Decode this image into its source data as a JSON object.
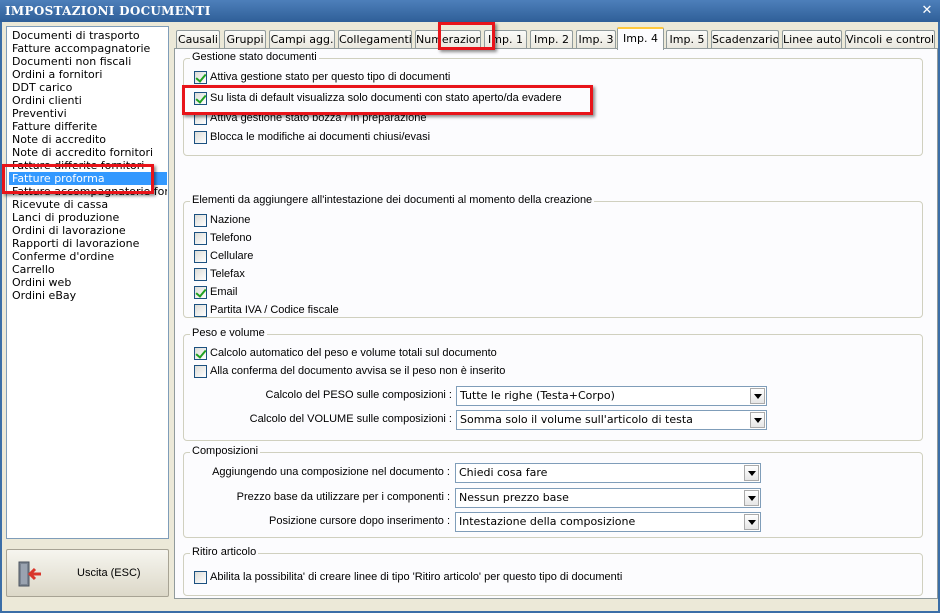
{
  "window": {
    "title": "IMPOSTAZIONI DOCUMENTI",
    "close_glyph": "✕"
  },
  "doc_list": {
    "items": [
      "Documenti di trasporto",
      "Fatture accompagnatorie",
      "Documenti non fiscali",
      "Ordini a fornitori",
      "DDT carico",
      "Ordini clienti",
      "Preventivi",
      "Fatture differite",
      "Note di accredito",
      "Note di accredito fornitori",
      "Fatture differite fornitori",
      "Fatture proforma",
      "Fatture accompagnatorie fornitori",
      "Ricevute di cassa",
      "Lanci di produzione",
      "Ordini di lavorazione",
      "Rapporti di lavorazione",
      "Conferme d'ordine",
      "Carrello",
      "Ordini web",
      "Ordini eBay"
    ],
    "selected": "Fatture proforma"
  },
  "exit_button": {
    "label": "Uscita (ESC)",
    "icon": "exit-door-icon"
  },
  "tabs": [
    "Causali",
    "Gruppi",
    "Campi agg.",
    "Collegamenti",
    "Numerazioni",
    "Imp. 1",
    "Imp. 2",
    "Imp. 3",
    "Imp. 4",
    "Imp. 5",
    "Scadenzario",
    "Linee auto",
    "Vincoli e controlli"
  ],
  "active_tab": "Imp. 4",
  "groups": {
    "stato": {
      "title": "Gestione stato documenti",
      "options": [
        {
          "label": "Attiva gestione stato per questo tipo di documenti",
          "checked": true
        },
        {
          "label": "Su lista di default visualizza solo documenti con stato aperto/da evadere",
          "checked": true
        },
        {
          "label": "Attiva gestione stato bozza / in preparazione",
          "checked": false
        },
        {
          "label": "Blocca le modifiche ai documenti chiusi/evasi",
          "checked": false
        }
      ]
    },
    "intestazione": {
      "title": "Elementi da aggiungere all'intestazione dei documenti al momento della creazione",
      "options": [
        {
          "label": "Nazione",
          "checked": false
        },
        {
          "label": "Telefono",
          "checked": false
        },
        {
          "label": "Cellulare",
          "checked": false
        },
        {
          "label": "Telefax",
          "checked": false
        },
        {
          "label": "Email",
          "checked": true
        },
        {
          "label": "Partita IVA / Codice fiscale",
          "checked": false
        }
      ]
    },
    "peso": {
      "title": "Peso e volume",
      "options": [
        {
          "label": "Calcolo automatico del peso e volume totali sul documento",
          "checked": true
        },
        {
          "label": "Alla conferma del documento avvisa se il peso non è inserito",
          "checked": false
        }
      ],
      "fields": [
        {
          "label": "Calcolo del PESO sulle composizioni :",
          "value": "Tutte le righe (Testa+Corpo)"
        },
        {
          "label": "Calcolo del VOLUME sulle composizioni :",
          "value": "Somma solo il volume sull'articolo di testa"
        }
      ]
    },
    "composizioni": {
      "title": "Composizioni",
      "fields": [
        {
          "label": "Aggiungendo una composizione nel documento :",
          "value": "Chiedi cosa fare"
        },
        {
          "label": "Prezzo base da utilizzare per i componenti :",
          "value": "Nessun prezzo base"
        },
        {
          "label": "Posizione cursore dopo inserimento :",
          "value": "Intestazione della composizione"
        }
      ]
    },
    "ritiro": {
      "title": "Ritiro articolo",
      "options": [
        {
          "label": "Abilita la possibilita' di creare linee di tipo 'Ritiro articolo' per questo tipo di documenti",
          "checked": false
        }
      ]
    }
  },
  "colors": {
    "title_bar": "#2f5f98",
    "selection": "#3399ff",
    "highlight_box": "#e8141a",
    "active_tab_accent": "#ffc83c",
    "check": "#21a121"
  }
}
